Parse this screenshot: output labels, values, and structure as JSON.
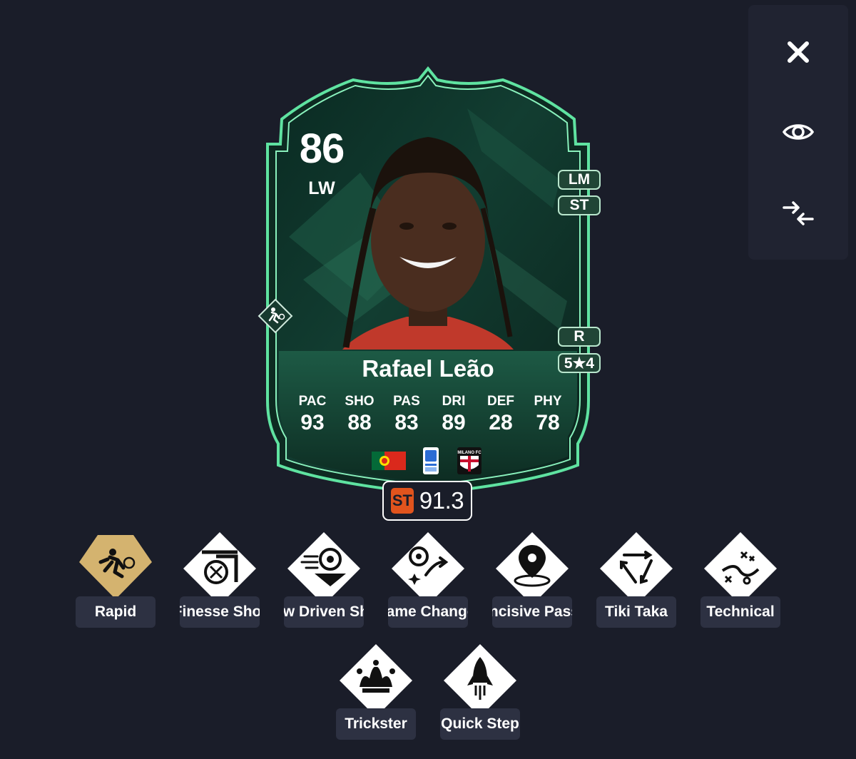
{
  "controls": {
    "close_icon": "close-icon",
    "view_icon": "eye-icon",
    "compare_icon": "compress-arrows-icon"
  },
  "card": {
    "rating": "86",
    "position": "LW",
    "alt_positions": [
      "LM",
      "ST"
    ],
    "foot": "R",
    "skill_weakfoot": "5★4",
    "name": "Rafael Leão",
    "stats": [
      {
        "label": "PAC",
        "value": "93"
      },
      {
        "label": "SHO",
        "value": "88"
      },
      {
        "label": "PAS",
        "value": "83"
      },
      {
        "label": "DRI",
        "value": "89"
      },
      {
        "label": "DEF",
        "value": "28"
      },
      {
        "label": "PHY",
        "value": "78"
      }
    ],
    "nation_flag": "portugal-flag",
    "league_badge": "serie-a-badge",
    "club_badge": "milano-fc-badge",
    "club_badge_text": "MILANO FC",
    "colors": {
      "card_dark": "#0f2e24",
      "card_glow": "#5fe3a1",
      "accent": "#e1541d",
      "gold": "#d4b36f"
    }
  },
  "role_rating": {
    "role": "ST",
    "value": "91.3"
  },
  "playstyles": [
    {
      "label": "Rapid",
      "icon": "rapid-icon",
      "plus": true
    },
    {
      "label": "Finesse Shot",
      "icon": "finesse-shot-icon",
      "plus": false
    },
    {
      "label": "Low Driven Shot",
      "icon": "low-driven-shot-icon",
      "plus": false
    },
    {
      "label": "Game Changer",
      "icon": "game-changer-icon",
      "plus": false
    },
    {
      "label": "Incisive Pass",
      "icon": "incisive-pass-icon",
      "plus": false
    },
    {
      "label": "Tiki Taka",
      "icon": "tiki-taka-icon",
      "plus": false
    },
    {
      "label": "Technical",
      "icon": "technical-icon",
      "plus": false
    },
    {
      "label": "Trickster",
      "icon": "trickster-icon",
      "plus": false
    },
    {
      "label": "Quick Step",
      "icon": "quick-step-icon",
      "plus": false
    }
  ]
}
